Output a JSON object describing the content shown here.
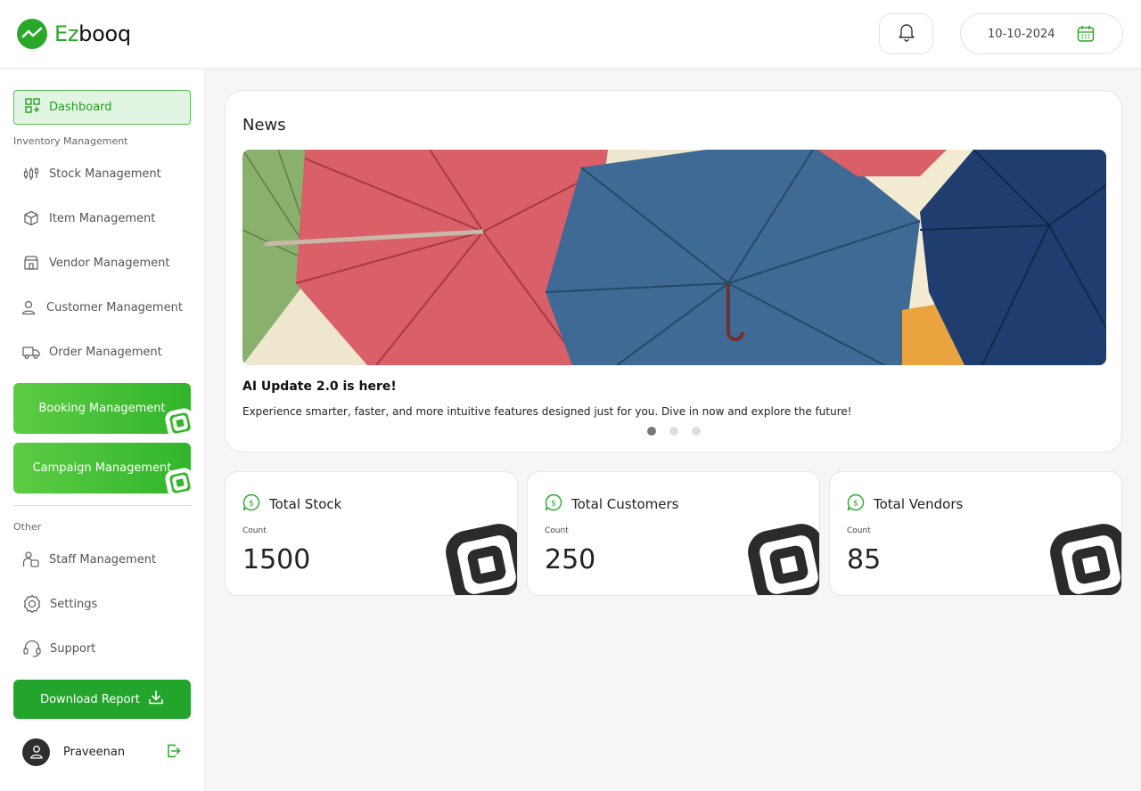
{
  "app": {
    "logo_prefix": "Ez",
    "logo_suffix": "booq",
    "date": "10-10-2024"
  },
  "sidebar": {
    "dashboard": "Dashboard",
    "inventory_label": "Inventory Management",
    "items": [
      {
        "label": "Stock Management",
        "icon": "stock-icon"
      },
      {
        "label": "Item Management",
        "icon": "box-icon"
      },
      {
        "label": "Vendor Management",
        "icon": "store-icon"
      },
      {
        "label": "Customer Management",
        "icon": "user-icon"
      },
      {
        "label": "Order Management",
        "icon": "truck-icon"
      }
    ],
    "booking": "Booking  Management",
    "campaign": "Campaign Management",
    "other_label": "Other",
    "other_items": [
      {
        "label": "Staff Management",
        "icon": "staff-icon"
      },
      {
        "label": "Settings",
        "icon": "gear-icon"
      },
      {
        "label": "Support",
        "icon": "headset-icon"
      }
    ],
    "download": "Download Report",
    "user": "Praveenan"
  },
  "news": {
    "title": "News",
    "headline": "AI Update 2.0 is here!",
    "body": "Experience smarter, faster, and more intuitive features designed just for you. Dive in now and explore the future!",
    "slides": 3,
    "active_slide": 1
  },
  "stats": [
    {
      "title": "Total Stock",
      "sub": "Count",
      "value": "1500"
    },
    {
      "title": "Total Customers",
      "sub": "Count",
      "value": "250"
    },
    {
      "title": "Total Vendors",
      "sub": "Count",
      "value": "85"
    }
  ],
  "colors": {
    "accent": "#2aa82a",
    "accent_light": "#e2f5e2"
  }
}
